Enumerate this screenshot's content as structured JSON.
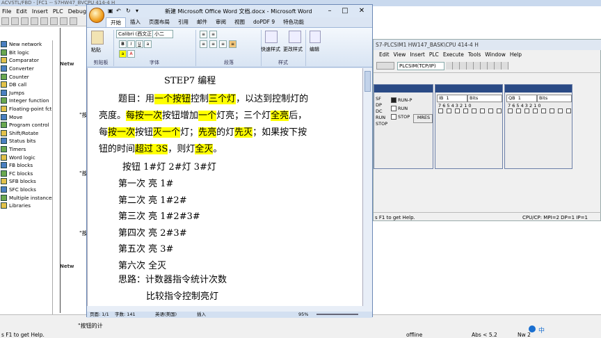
{
  "background_app": {
    "title": "ACVSTL/FBD -  [FC1 -- S7HW47_BVCPU 414-4 H",
    "menu": [
      "File",
      "Edit",
      "Insert",
      "PLC",
      "Debug"
    ],
    "tree_items": [
      {
        "label": "New network",
        "icon": "new-network-icon"
      },
      {
        "label": "Bit logic",
        "icon": "bit-logic-icon"
      },
      {
        "label": "Comparator",
        "icon": "comparator-icon"
      },
      {
        "label": "Converter",
        "icon": "converter-icon"
      },
      {
        "label": "Counter",
        "icon": "counter-icon"
      },
      {
        "label": "DB call",
        "icon": "db-call-icon"
      },
      {
        "label": "Jumps",
        "icon": "jumps-icon"
      },
      {
        "label": "Integer function",
        "icon": "integer-function-icon"
      },
      {
        "label": "Floating-point fct.",
        "icon": "floating-point-icon"
      },
      {
        "label": "Move",
        "icon": "move-icon"
      },
      {
        "label": "Program control",
        "icon": "program-control-icon"
      },
      {
        "label": "Shift/Rotate",
        "icon": "shift-rotate-icon"
      },
      {
        "label": "Status bits",
        "icon": "status-bits-icon"
      },
      {
        "label": "Timers",
        "icon": "timers-icon"
      },
      {
        "label": "Word logic",
        "icon": "word-logic-icon"
      },
      {
        "label": "FB blocks",
        "icon": "fb-blocks-icon"
      },
      {
        "label": "FC blocks",
        "icon": "fc-blocks-icon"
      },
      {
        "label": "SFB blocks",
        "icon": "sfb-blocks-icon"
      },
      {
        "label": "SFC blocks",
        "icon": "sfc-blocks-icon"
      },
      {
        "label": "Multiple instances",
        "icon": "multiple-instances-icon"
      },
      {
        "label": "Libraries",
        "icon": "libraries-icon"
      }
    ],
    "network_labels": [
      "Netw",
      "Netw"
    ],
    "lad_snippets": [
      "\"按",
      "\"按",
      "\"按"
    ],
    "bottom_left_text": "\"按钮的计",
    "status_help": "s F1 to get Help.",
    "status_offline": "offline",
    "status_abs": "Abs < 5.2",
    "status_nw": "Nw 2",
    "tray_lang": "中"
  },
  "word": {
    "title": "新建 Microsoft Office Word 文档.docx - Microsoft Word",
    "tabs": [
      "开始",
      "插入",
      "页面布局",
      "引用",
      "邮件",
      "审阅",
      "视图",
      "doPDF 9",
      "特色功能"
    ],
    "active_tab": "开始",
    "ribbon": {
      "paste": "粘贴",
      "clipboard": "剪贴板",
      "font_name": "Calibri (西文正",
      "font_size": "小二",
      "font_group": "字体",
      "paragraph_group": "段落",
      "style_group": "样式",
      "quick_styles": "快速样式",
      "change_styles": "更改样式",
      "edit": "编辑"
    },
    "doc": {
      "heading": "STEP7 编程",
      "lines": [
        [
          {
            "t": "题目：用"
          },
          {
            "t": "一个按钮",
            "h": true
          },
          {
            "t": "控制"
          },
          {
            "t": "三个灯",
            "h": true
          },
          {
            "t": "，以达到控制灯的"
          }
        ],
        [
          {
            "t": "亮度。"
          },
          {
            "t": "每按一次",
            "h": true
          },
          {
            "t": "按钮增加"
          },
          {
            "t": "一个",
            "h": true
          },
          {
            "t": "灯亮；三个灯"
          },
          {
            "t": "全亮",
            "h": true
          },
          {
            "t": "后，"
          }
        ],
        [
          {
            "t": "每"
          },
          {
            "t": "按一次",
            "h": true
          },
          {
            "t": "按钮"
          },
          {
            "t": "灭一个",
            "h": true
          },
          {
            "t": "灯；"
          },
          {
            "t": "先亮",
            "h": true
          },
          {
            "t": "的灯"
          },
          {
            "t": "先灭",
            "h": true
          },
          {
            "t": "；如果按下按"
          }
        ],
        [
          {
            "t": "钮的时间"
          },
          {
            "t": "超过 3S",
            "h": true
          },
          {
            "t": "，则灯"
          },
          {
            "t": "全灭",
            "h": true
          },
          {
            "t": "。"
          }
        ]
      ],
      "table_header": "按钮      1#灯     2#灯     3#灯",
      "rows": [
        "第一次   亮 1#",
        "第二次   亮 1#2#",
        "第三次   亮 1#2#3#",
        "第四次   亮 2#3#",
        "第五次   亮 3#",
        "第六次   全灭"
      ],
      "idea1": "思路：计数器指令统计次数",
      "idea2": "比较指令控制亮灯"
    },
    "status": {
      "page": "页面: 1/1",
      "words": "字数: 141",
      "lang": "英语(美国)",
      "mode": "插入",
      "zoom": "95%"
    }
  },
  "plcsim": {
    "title": "S7-PLCSIM1   HW147_BASK\\CPU 414-4 H",
    "menu": [
      "Edit",
      "View",
      "Insert",
      "PLC",
      "Execute",
      "Tools",
      "Window",
      "Help"
    ],
    "interface": "PLCSIM(TCP/IP)",
    "cpu": {
      "labels": [
        "SF",
        "DP",
        "DC",
        "RUN",
        "STOP"
      ],
      "options": [
        "RUN-P",
        "RUN",
        "STOP"
      ],
      "mres": "MRES"
    },
    "ib": {
      "addr": "IB",
      "val": "1",
      "fmt": "Bits",
      "bits": "7 6 5 4  3 2 1 0"
    },
    "qb": {
      "addr": "QB",
      "val": "1",
      "fmt": "Bits",
      "bits": "7 6 5 4  3 2 1 0"
    },
    "help": "s F1 to get Help.",
    "cpu_status": "CPU/CP:  MPI=2 DP=1 IP=1"
  }
}
